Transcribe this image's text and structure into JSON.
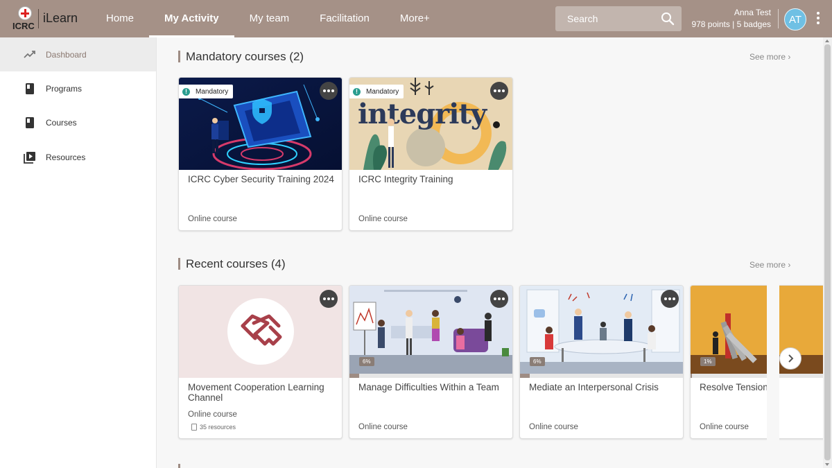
{
  "topbar": {
    "logo_text": "ICRC",
    "app_name": "iLearn",
    "nav": [
      "Home",
      "My Activity",
      "My team",
      "Facilitation",
      "More+"
    ],
    "active_nav": "My Activity",
    "search_placeholder": "Search",
    "user": {
      "name": "Anna Test",
      "stats": "978 points | 5 badges",
      "initials": "AT"
    }
  },
  "sidebar": {
    "items": [
      {
        "label": "Dashboard",
        "icon": "trend-icon",
        "active": true
      },
      {
        "label": "Programs",
        "icon": "book-icon"
      },
      {
        "label": "Courses",
        "icon": "book-icon"
      },
      {
        "label": "Resources",
        "icon": "play-library-icon"
      }
    ]
  },
  "mandatory": {
    "title": "Mandatory courses (2)",
    "see_more": "See more",
    "badge_label": "Mandatory",
    "cards": [
      {
        "title": "ICRC Cyber Security Training 2024",
        "type": "Online course",
        "image": "cyber-security-illustration"
      },
      {
        "title": "ICRC Integrity Training",
        "type": "Online course",
        "image": "integrity-illustration",
        "image_text": "integrity"
      }
    ]
  },
  "recent": {
    "title": "Recent courses (4)",
    "see_more": "See more",
    "cards": [
      {
        "title": "Movement Cooperation Learning Channel",
        "type": "Online course",
        "resources": "35 resources",
        "image": "handshake-icon"
      },
      {
        "title": "Manage Difficulties Within a Team",
        "type": "Online course",
        "progress": "6%",
        "progress_value": 0.06,
        "image": "office-team-illustration"
      },
      {
        "title": "Mediate an Interpersonal Crisis",
        "type": "Online course",
        "progress": "6%",
        "progress_value": 0.06,
        "image": "meeting-illustration"
      },
      {
        "title": "Resolve Tensions",
        "type": "Online course",
        "progress": "1%",
        "progress_value": 0.01,
        "image": "dominoes-illustration"
      }
    ]
  },
  "colors": {
    "topbar": "#a59187",
    "accent": "#9e8c84",
    "avatar": "#6fc0e4",
    "badge_icon": "#2a9d8f"
  }
}
